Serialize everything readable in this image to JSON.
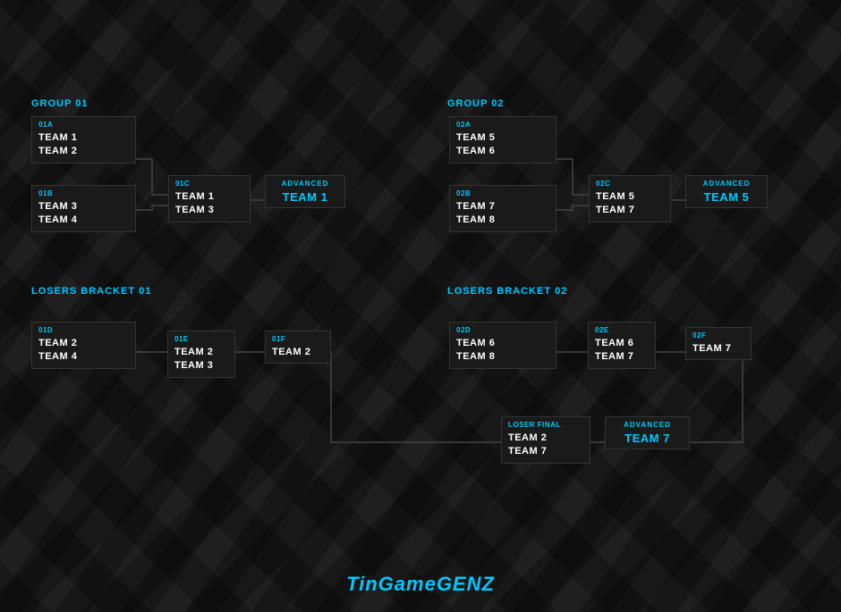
{
  "sections": {
    "group01_label": "GROUP 01",
    "group02_label": "GROUP 02",
    "losers01_label": "LOSERS BRACKET 01",
    "losers02_label": "LOSERS BRACKET 02"
  },
  "matches": {
    "m01a": {
      "round": "01A",
      "teams": [
        "TEAM 1",
        "TEAM 2"
      ]
    },
    "m01b": {
      "round": "01B",
      "teams": [
        "TEAM 3",
        "TEAM 4"
      ]
    },
    "m01c": {
      "round": "01C",
      "teams": [
        "TEAM 1",
        "TEAM 3"
      ]
    },
    "m01d": {
      "round": "01D",
      "teams": [
        "TEAM 2",
        "TEAM 4"
      ]
    },
    "m01e": {
      "round": "01E",
      "teams": [
        "TEAM 2",
        "TEAM 3"
      ]
    },
    "m01f": {
      "round": "01F",
      "teams": [
        "TEAM 2"
      ]
    },
    "m02a": {
      "round": "02A",
      "teams": [
        "TEAM 5",
        "TEAM 6"
      ]
    },
    "m02b": {
      "round": "02B",
      "teams": [
        "TEAM 7",
        "TEAM 8"
      ]
    },
    "m02c": {
      "round": "02C",
      "teams": [
        "TEAM 5",
        "TEAM 7"
      ]
    },
    "m02d": {
      "round": "02D",
      "teams": [
        "TEAM 6",
        "TEAM 8"
      ]
    },
    "m02e": {
      "round": "02E",
      "teams": [
        "TEAM 6",
        "TEAM 7"
      ]
    },
    "m02f": {
      "round": "02F",
      "teams": [
        "TEAM 7"
      ]
    },
    "loser_final": {
      "round": "LOSER FINAL",
      "teams": [
        "TEAM 2",
        "TEAM 7"
      ]
    }
  },
  "advanced": {
    "adv01": {
      "label": "ADVANCED",
      "team": "TEAM 1"
    },
    "adv02": {
      "label": "ADVANCED",
      "team": "TEAM 5"
    },
    "adv_loser": {
      "label": "ADVANCED",
      "team": "TEAM 7"
    }
  },
  "watermark": {
    "prefix": "TinGame",
    "suffix": "GENZ"
  }
}
